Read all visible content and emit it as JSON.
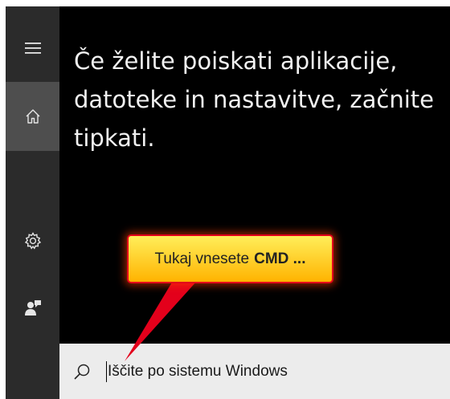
{
  "sidebar": {
    "items": [
      {
        "name": "menu",
        "icon": "hamburger-icon"
      },
      {
        "name": "home",
        "icon": "home-icon",
        "selected": true
      },
      {
        "name": "settings",
        "icon": "gear-icon"
      },
      {
        "name": "feedback",
        "icon": "person-icon"
      }
    ]
  },
  "main": {
    "hint": "Če želite poiskati aplikacije, datoteke in nastavitve, začnite tipkati."
  },
  "search": {
    "placeholder": "Iščite po sistemu Windows",
    "icon": "search-icon"
  },
  "annotation": {
    "text": "Tukaj vnesete",
    "bold_text": "CMD ...",
    "colors": {
      "fill_top": "#ffee5a",
      "fill_bottom": "#ffb300",
      "border": "#e3001b",
      "arrow": "#e3001b"
    }
  },
  "colors": {
    "sidebar": "#2b2b2b",
    "sidebar_selected": "#4e4e4e",
    "panel": "#000000",
    "searchbar": "#ececec"
  }
}
